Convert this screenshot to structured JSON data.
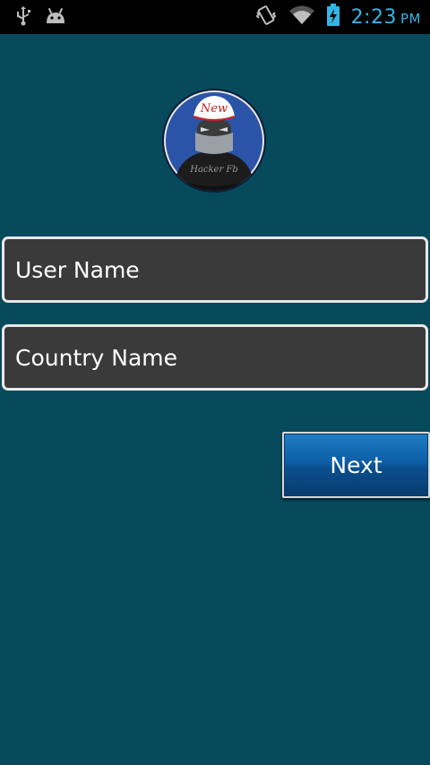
{
  "status_bar": {
    "time": "2:23",
    "ampm": "PM",
    "icons": [
      "usb-icon",
      "android-debug-icon",
      "vibrate-icon",
      "wifi-icon",
      "battery-charging-icon"
    ]
  },
  "logo": {
    "cap_text": "New",
    "shirt_text": "Hacker Fb"
  },
  "form": {
    "username_placeholder": "User Name",
    "country_placeholder": "Country Name",
    "next_label": "Next"
  },
  "colors": {
    "background": "#064a5c",
    "status_accent": "#33b5e5",
    "field_fill": "#3a3a3a",
    "button_blue": "#0d5ea6"
  }
}
